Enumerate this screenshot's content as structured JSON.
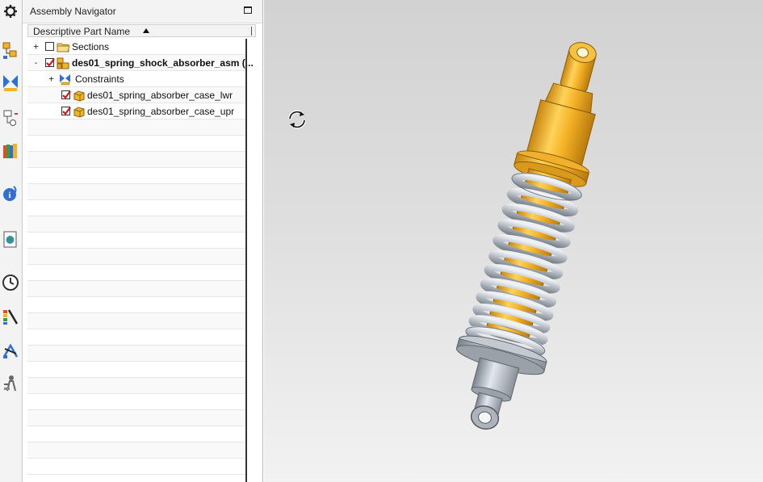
{
  "navigator": {
    "title": "Assembly Navigator",
    "column_header": "Descriptive Part Name",
    "sort_order": "ascending",
    "items": [
      {
        "label": "Sections",
        "level": 0,
        "expander": "+",
        "checked": false,
        "icon": "folder-icon",
        "bold": false
      },
      {
        "label": "des01_spring_shock_absorber_asm (...",
        "level": 0,
        "expander": "-",
        "checked": true,
        "icon": "assembly-icon",
        "bold": true
      },
      {
        "label": "Constraints",
        "level": 1,
        "expander": "+",
        "checked": null,
        "icon": "constraints-icon",
        "bold": false
      },
      {
        "label": "des01_spring_absorber_case_lwr",
        "level": 1,
        "expander": null,
        "checked": true,
        "icon": "part-icon",
        "bold": false
      },
      {
        "label": "des01_spring_absorber_case_upr",
        "level": 1,
        "expander": null,
        "checked": true,
        "icon": "part-icon",
        "bold": false
      }
    ]
  },
  "resource_bar": {
    "icons": [
      "settings-gear-icon",
      "assembly-navigator-icon",
      "constraint-navigator-icon",
      "part-navigator-icon",
      "reuse-library-icon",
      "hd3d-tools-icon",
      "web-browser-icon",
      "history-icon",
      "system-materials-icon",
      "process-studio-icon",
      "roles-icon"
    ]
  },
  "graphics": {
    "cursor": "rotate-cursor-icon",
    "model": "spring-shock-absorber",
    "colors": {
      "body": "#f2b32a",
      "spring": "#b9c0c8",
      "metal": "#a8aeb6"
    }
  }
}
